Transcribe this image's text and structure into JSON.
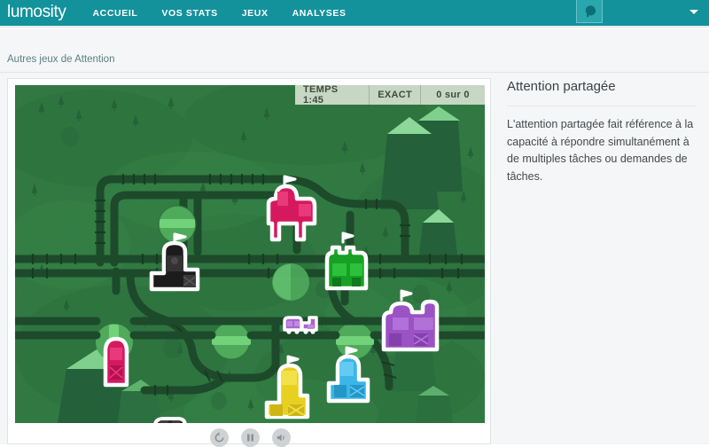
{
  "header": {
    "brand": "lumosity",
    "nav_items": [
      {
        "label": "ACCUEIL",
        "name": "nav-accueil"
      },
      {
        "label": "VOS STATS",
        "name": "nav-vos-stats"
      },
      {
        "label": "JEUX",
        "name": "nav-jeux"
      },
      {
        "label": "ANALYSES",
        "name": "nav-analyses"
      }
    ],
    "avatar_icon": "user-head-icon",
    "caret_icon": "chevron-down-icon",
    "background_color": "#13929c"
  },
  "breadcrumb": {
    "label": "Autres jeux de Attention"
  },
  "game": {
    "hud": {
      "time_label": "TEMPS 1:45",
      "mode_label": "EXACT",
      "score_label": "0 sur 0"
    },
    "controls": [
      {
        "name": "replay-button",
        "icon": "replay-icon"
      },
      {
        "name": "pause-button",
        "icon": "pause-icon"
      },
      {
        "name": "sound-button",
        "icon": "sound-icon"
      }
    ],
    "board": {
      "grass_color": "#2f7840",
      "track_color": "#1d4a2b",
      "switch_color": "#4faa5c",
      "switch_bar_color": "#72d27a",
      "stations": [
        {
          "name": "station-black",
          "color": "#1c1c1c",
          "accent": "#333333"
        },
        {
          "name": "station-crimson",
          "color": "#d6195e",
          "accent": "#e8397b"
        },
        {
          "name": "station-green",
          "color": "#17a024",
          "accent": "#2bc23a"
        },
        {
          "name": "station-purple",
          "color": "#9b52c4",
          "accent": "#b071d8"
        },
        {
          "name": "station-blue",
          "color": "#3ab6e8",
          "accent": "#63caf2"
        },
        {
          "name": "station-yellow",
          "color": "#e8d020",
          "accent": "#f3e14a"
        },
        {
          "name": "station-crimson-small",
          "color": "#d6195e",
          "accent": "#e8397b"
        }
      ],
      "trains": [
        {
          "name": "train-purple",
          "color": "#a765cf"
        },
        {
          "name": "train-black",
          "color": "#2a2a2a"
        }
      ]
    }
  },
  "side_panel": {
    "title": "Attention partagée",
    "body": "L'attention partagée fait référence à la capacité à répondre simultanément à de multiples tâches ou demandes de tâches."
  }
}
